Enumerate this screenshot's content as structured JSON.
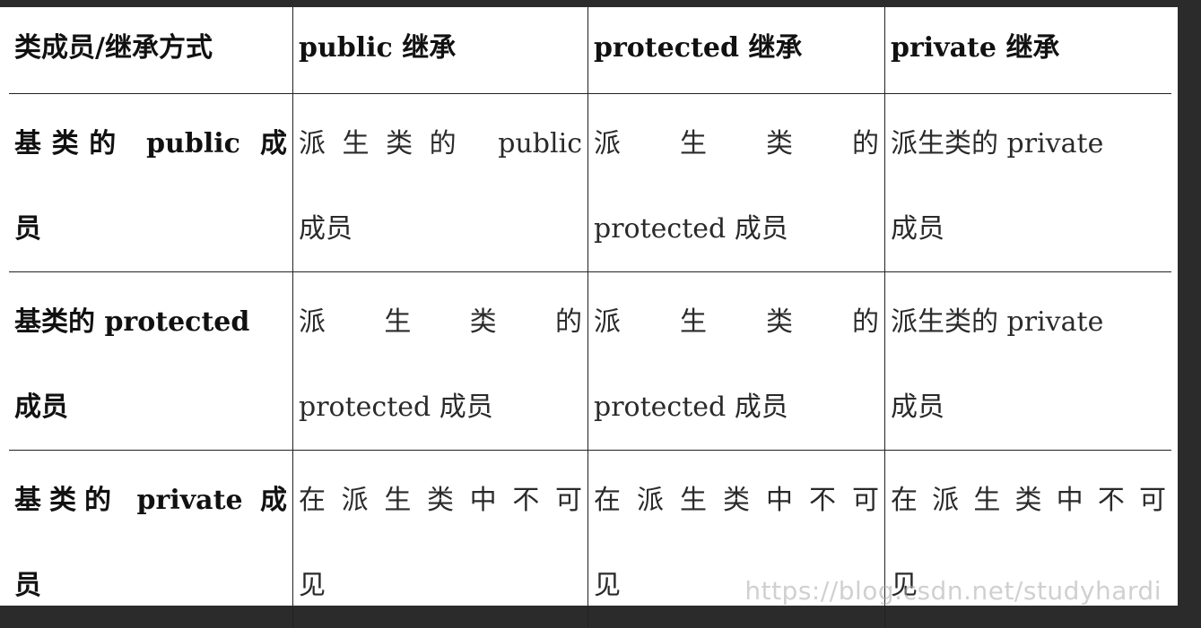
{
  "table": {
    "header": [
      "类成员/继承方式",
      "public 继承",
      "protected 继承",
      "private 继承"
    ],
    "rows": [
      {
        "member": [
          "基类的 public 成",
          "员"
        ],
        "public": [
          "派生类的 public",
          "成员"
        ],
        "protected": [
          "派　生　类　的",
          "protected 成员"
        ],
        "private": [
          "派生类的 private",
          "成员"
        ]
      },
      {
        "member": [
          "基类的 protected",
          "成员"
        ],
        "public": [
          "派　生　类　的",
          "protected 成员"
        ],
        "protected": [
          "派　生　类　的",
          "protected 成员"
        ],
        "private": [
          "派生类的 private",
          "成员"
        ]
      },
      {
        "member": [
          "基类的 private 成",
          "员"
        ],
        "public": [
          "在派生类中不可",
          "见"
        ],
        "protected": [
          "在派生类中不可",
          "见"
        ],
        "private": [
          "在派生类中不可",
          "见"
        ]
      }
    ]
  },
  "watermark": "https://blog.csdn.net/studyhardi"
}
